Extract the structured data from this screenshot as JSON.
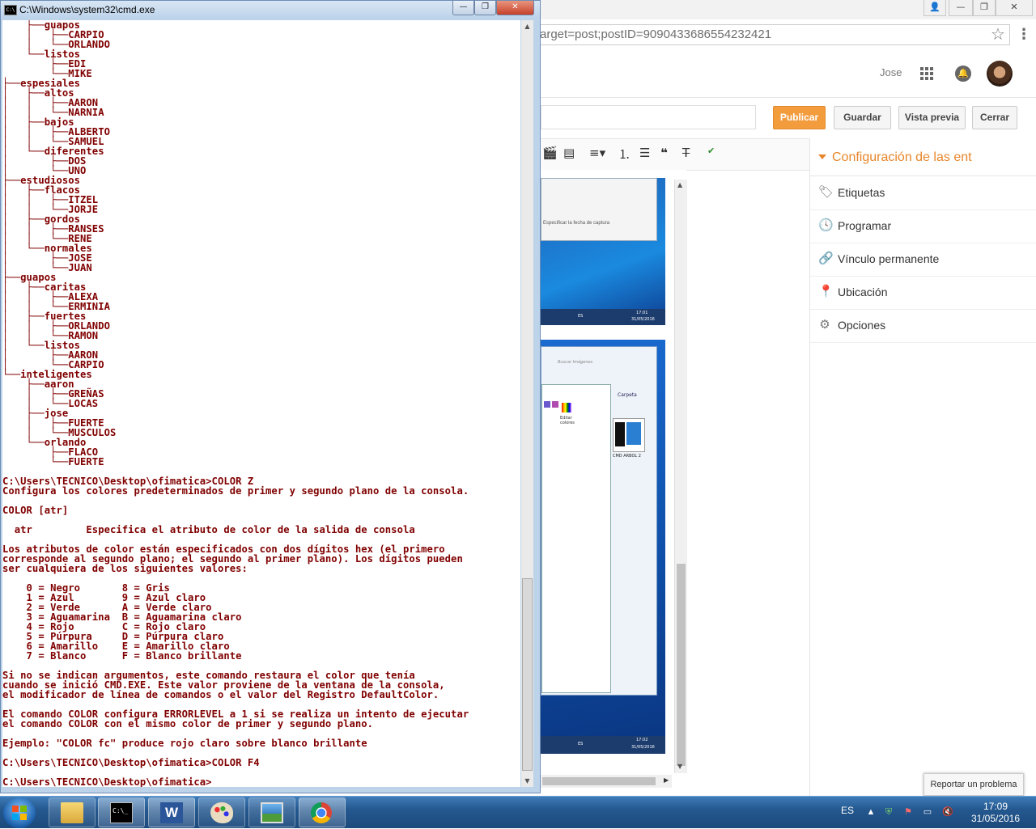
{
  "cmd": {
    "title": "C:\\Windows\\system32\\cmd.exe",
    "icon_text": "C:\\",
    "buttons": {
      "minimize": "—",
      "maximize": "❐",
      "close": "✕"
    },
    "lines": [
      "    ├──guapos",
      "    │   ├──CARPIO",
      "    │   └──ORLANDO",
      "    └──listos",
      "        ├──EDI",
      "        └──MIKE",
      "├──espesiales",
      "│   ├──altos",
      "│   │   ├──AARON",
      "│   │   └──NARNIA",
      "│   ├──bajos",
      "│   │   ├──ALBERTO",
      "│   │   └──SAMUEL",
      "│   └──diferentes",
      "│       ├──DOS",
      "│       └──UNO",
      "├──estudiosos",
      "│   ├──flacos",
      "│   │   ├──ITZEL",
      "│   │   └──JORJE",
      "│   ├──gordos",
      "│   │   ├──RANSES",
      "│   │   └──RENE",
      "│   └──normales",
      "│       ├──JOSE",
      "│       └──JUAN",
      "├──guapos",
      "│   ├──caritas",
      "│   │   ├──ALEXA",
      "│   │   └──ERMINIA",
      "│   ├──fuertes",
      "│   │   ├──ORLANDO",
      "│   │   └──RAMON",
      "│   └──listos",
      "│       ├──AARON",
      "│       └──CARPIO",
      "└──inteligentes",
      "    ├──aaron",
      "    │   ├──GREÑAS",
      "    │   └──LOCAS",
      "    ├──jose",
      "    │   ├──FUERTE",
      "    │   └──MUSCULOS",
      "    └──orlando",
      "        ├──FLACO",
      "        └──FUERTE",
      "",
      "C:\\Users\\TECNICO\\Desktop\\ofimatica>COLOR Z",
      "Configura los colores predeterminados de primer y segundo plano de la consola.",
      "",
      "COLOR [atr]",
      "",
      "  atr         Especifica el atributo de color de la salida de consola",
      "",
      "Los atributos de color están especificados con dos dígitos hex (el primero",
      "corresponde al segundo plano; el segundo al primer plano). Los dígitos pueden",
      "ser cualquiera de los siguientes valores:",
      "",
      "    0 = Negro       8 = Gris",
      "    1 = Azul        9 = Azul claro",
      "    2 = Verde       A = Verde claro",
      "    3 = Aguamarina  B = Aguamarina claro",
      "    4 = Rojo        C = Rojo claro",
      "    5 = Púrpura     D = Púrpura claro",
      "    6 = Amarillo    E = Amarillo claro",
      "    7 = Blanco      F = Blanco brillante",
      "",
      "Si no se indican argumentos, este comando restaura el color que tenía",
      "cuando se inició CMD.EXE. Este valor proviene de la ventana de la consola,",
      "el modificador de línea de comandos o el valor del Registro DefaultColor.",
      "",
      "El comando COLOR configura ERRORLEVEL a 1 si se realiza un intento de ejecutar",
      "el comando COLOR con el mismo color de primer y segundo plano.",
      "",
      "Ejemplo: \"COLOR fc\" produce rojo claro sobre blanco brillante",
      "",
      "C:\\Users\\TECNICO\\Desktop\\ofimatica>COLOR F4",
      "",
      "C:\\Users\\TECNICO\\Desktop\\ofimatica>"
    ],
    "text_color": "#800000",
    "background": "#ffffff"
  },
  "browser": {
    "url": "arget=post;postID=9090433686554232421",
    "user_name": "Jose",
    "buttons": {
      "publish": "Publicar",
      "save": "Guardar",
      "preview": "Vista previa",
      "close": "Cerrar"
    },
    "sidebar": {
      "header": "Configuración de las ent",
      "items": [
        {
          "label": "Etiquetas",
          "icon": "tag-icon"
        },
        {
          "label": "Programar",
          "icon": "clock-icon"
        },
        {
          "label": "Vínculo permanente",
          "icon": "link-icon"
        },
        {
          "label": "Ubicación",
          "icon": "location-pin-icon"
        },
        {
          "label": "Opciones",
          "icon": "gear-icon"
        }
      ]
    },
    "screenshot1": {
      "caption": "Especificar la fecha de captura",
      "tray_lang": "ES",
      "tray_time": "17:01",
      "tray_date": "31/05/2016"
    },
    "screenshot2": {
      "search_placeholder": "Buscar Imágenes",
      "folder_label": "Carpeta",
      "item_label": "CMD ARBOL 2",
      "edit_colors": "Editar colores",
      "tray_lang": "ES",
      "tray_time": "17:02",
      "tray_date": "31/05/2016"
    },
    "report_problem": "Reportar un problema",
    "accent_color": "#e8862b",
    "publish_color": "#f39c3d"
  },
  "taskbar": {
    "apps": [
      "file-explorer-icon",
      "cmd-icon",
      "word-icon",
      "paint-icon",
      "photo-viewer-icon",
      "chrome-icon"
    ],
    "language": "ES",
    "time": "17:09",
    "date": "31/05/2016"
  }
}
